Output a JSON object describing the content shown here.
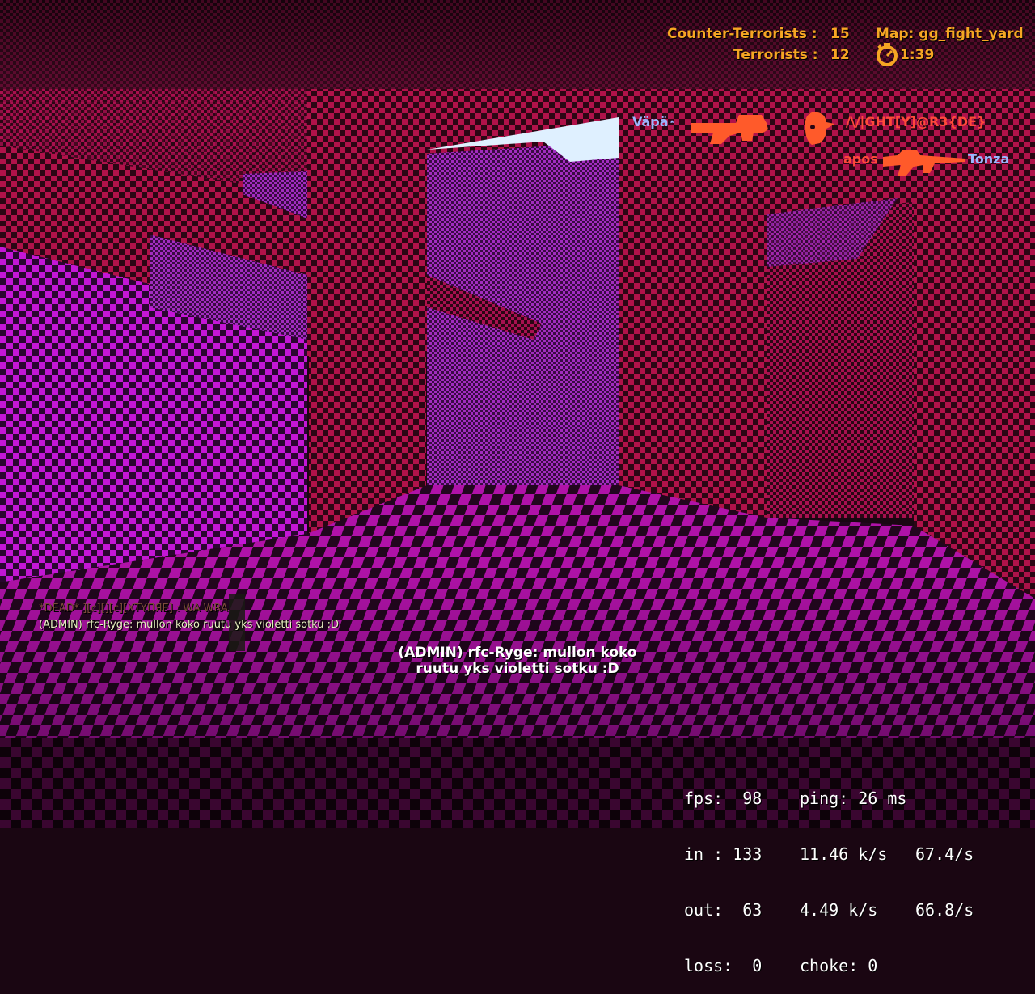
{
  "hud": {
    "ct_label": "Counter-Terrorists :",
    "ct_score": "15",
    "t_label": "Terrorists :",
    "t_score": "12",
    "map_label": "Map: gg_fight_yard",
    "timer": "1:39"
  },
  "killfeed": [
    {
      "killer": "Väpäٛ",
      "weapon_icon": "p90-icon",
      "victim": "/\\/|GHT[Y]@R3{DE}",
      "victim_icon": "headshot-icon"
    },
    {
      "killer": "apos",
      "weapon_icon": "aug-icon",
      "victim": "Tonza"
    }
  ],
  "chat": [
    {
      "text": "*DEAD* ][c][][c][XTYПЯЕ] : WA WRA",
      "type": "dead"
    },
    {
      "text": "(ADMIN) rfc-Ryge: mullon koko ruutu yks violetti sotku :D",
      "type": "admin"
    }
  ],
  "center_message": {
    "line1": "(ADMIN) rfc-Ryge: mullon koko",
    "line2": "ruutu yks violetti sotku :D"
  },
  "netgraph": {
    "fps": "fps:  98",
    "ping": "ping: 26 ms",
    "in": "in : 133",
    "in_rate": "11.46 k/s",
    "in_peak": "67.4/s",
    "out": "out:  63",
    "out_rate": "4.49 k/s",
    "out_peak": "66.8/s",
    "loss": "loss:  0",
    "choke": "choke: 0"
  },
  "colors": {
    "score": "#f5a623",
    "ct_name": "#9bb7ff",
    "t_name": "#ff4a3a",
    "checker_magenta": "#c010d0",
    "checker_red": "#a0103a"
  }
}
